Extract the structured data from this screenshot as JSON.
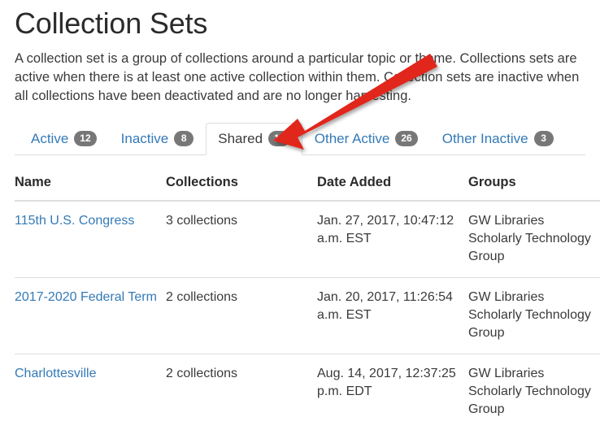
{
  "header": {
    "title": "Collection Sets",
    "description": "A collection set is a group of collections around a particular topic or theme. Collections sets are active when there is at least one active collection within them. Collection sets are inactive when all collections have been deactivated and are no longer harvesting."
  },
  "tabs": [
    {
      "label": "Active",
      "badge": "12",
      "active": false
    },
    {
      "label": "Inactive",
      "badge": "8",
      "active": false
    },
    {
      "label": "Shared",
      "badge": "11",
      "active": true
    },
    {
      "label": "Other Active",
      "badge": "26",
      "active": false
    },
    {
      "label": "Other Inactive",
      "badge": "3",
      "active": false
    }
  ],
  "table": {
    "columns": [
      "Name",
      "Collections",
      "Date Added",
      "Groups"
    ],
    "rows": [
      {
        "name": "115th U.S. Congress",
        "collections": "3 collections",
        "date_added": "Jan. 27, 2017, 10:47:12 a.m. EST",
        "groups": "GW Libraries Scholarly Technology Group"
      },
      {
        "name": "2017-2020 Federal Term",
        "collections": "2 collections",
        "date_added": "Jan. 20, 2017, 11:26:54 a.m. EST",
        "groups": "GW Libraries Scholarly Technology Group"
      },
      {
        "name": "Charlottesville",
        "collections": "2 collections",
        "date_added": "Aug. 14, 2017, 12:37:25 p.m. EDT",
        "groups": "GW Libraries Scholarly Technology Group"
      }
    ]
  },
  "annotation": {
    "arrow_color": "#e1251b",
    "arrow_target": "Shared tab"
  },
  "colors": {
    "link": "#337ab7",
    "badge_bg": "#777777",
    "border": "#dddddd",
    "text": "#3a3a3a"
  }
}
